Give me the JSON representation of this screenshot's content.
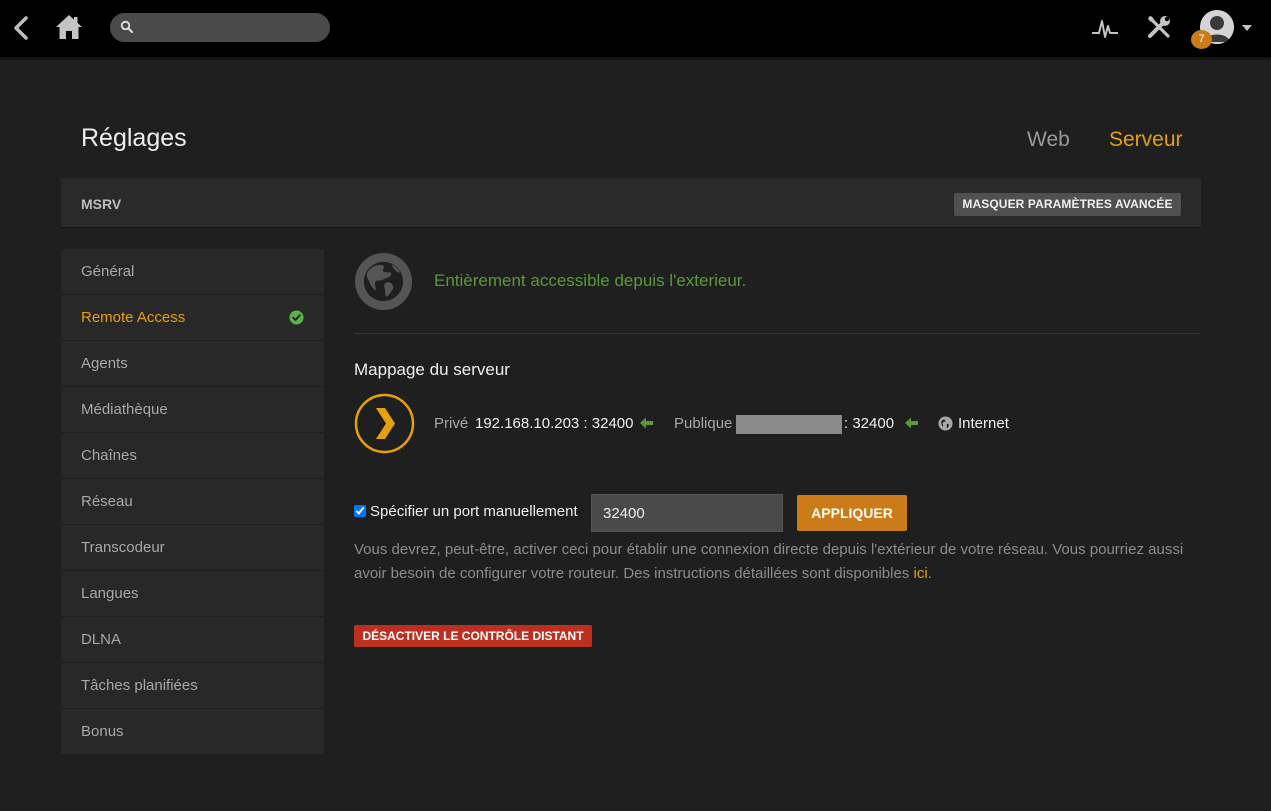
{
  "topbar": {
    "search_placeholder": "",
    "notification_count": "7",
    "icons": [
      "back-icon",
      "home-icon",
      "search-icon",
      "activity-icon",
      "settings-icon",
      "user-avatar",
      "caret-down-icon"
    ]
  },
  "header": {
    "title": "Réglages",
    "tabs": [
      {
        "label": "Web",
        "active": false
      },
      {
        "label": "Serveur",
        "active": true
      }
    ]
  },
  "server_bar": {
    "server_name": "MSRV",
    "advanced_button": "MASQUER PARAMÈTRES AVANCÉE"
  },
  "sidebar": {
    "items": [
      {
        "label": "Général"
      },
      {
        "label": "Remote Access",
        "active": true,
        "status_icon": "check-circle-icon"
      },
      {
        "label": "Agents"
      },
      {
        "label": "Médiathèque"
      },
      {
        "label": "Chaînes"
      },
      {
        "label": "Réseau"
      },
      {
        "label": "Transcodeur"
      },
      {
        "label": "Langues"
      },
      {
        "label": "DLNA"
      },
      {
        "label": "Tâches planifiées"
      },
      {
        "label": "Bonus"
      }
    ]
  },
  "main": {
    "status_text": "Entièrement accessible depuis l'exterieur.",
    "mapping_title": "Mappage du serveur",
    "private_label": "Privé",
    "private_value": "192.168.10.203 : 32400",
    "public_label": "Publique",
    "public_port": ": 32400",
    "internet_label": "Internet",
    "manual_port_label": "Spécifier un port manuellement",
    "manual_port_checked": true,
    "port_value": "32400",
    "apply_button": "APPLIQUER",
    "help_text": "Vous devrez, peut-être, activer ceci pour établir une connexion directe depuis l'extérieur de votre réseau. Vous pourriez aussi avoir besoin de configurer votre routeur. Des instructions détaillées sont disponibles ",
    "help_link": "ici",
    "help_end": ".",
    "disable_button": "DÉSACTIVER LE CONTRÔLE DISTANT"
  },
  "colors": {
    "accent": "#e5a00d",
    "success": "#5a9a38",
    "danger": "#bd3021",
    "button_orange": "#cc7b19"
  }
}
